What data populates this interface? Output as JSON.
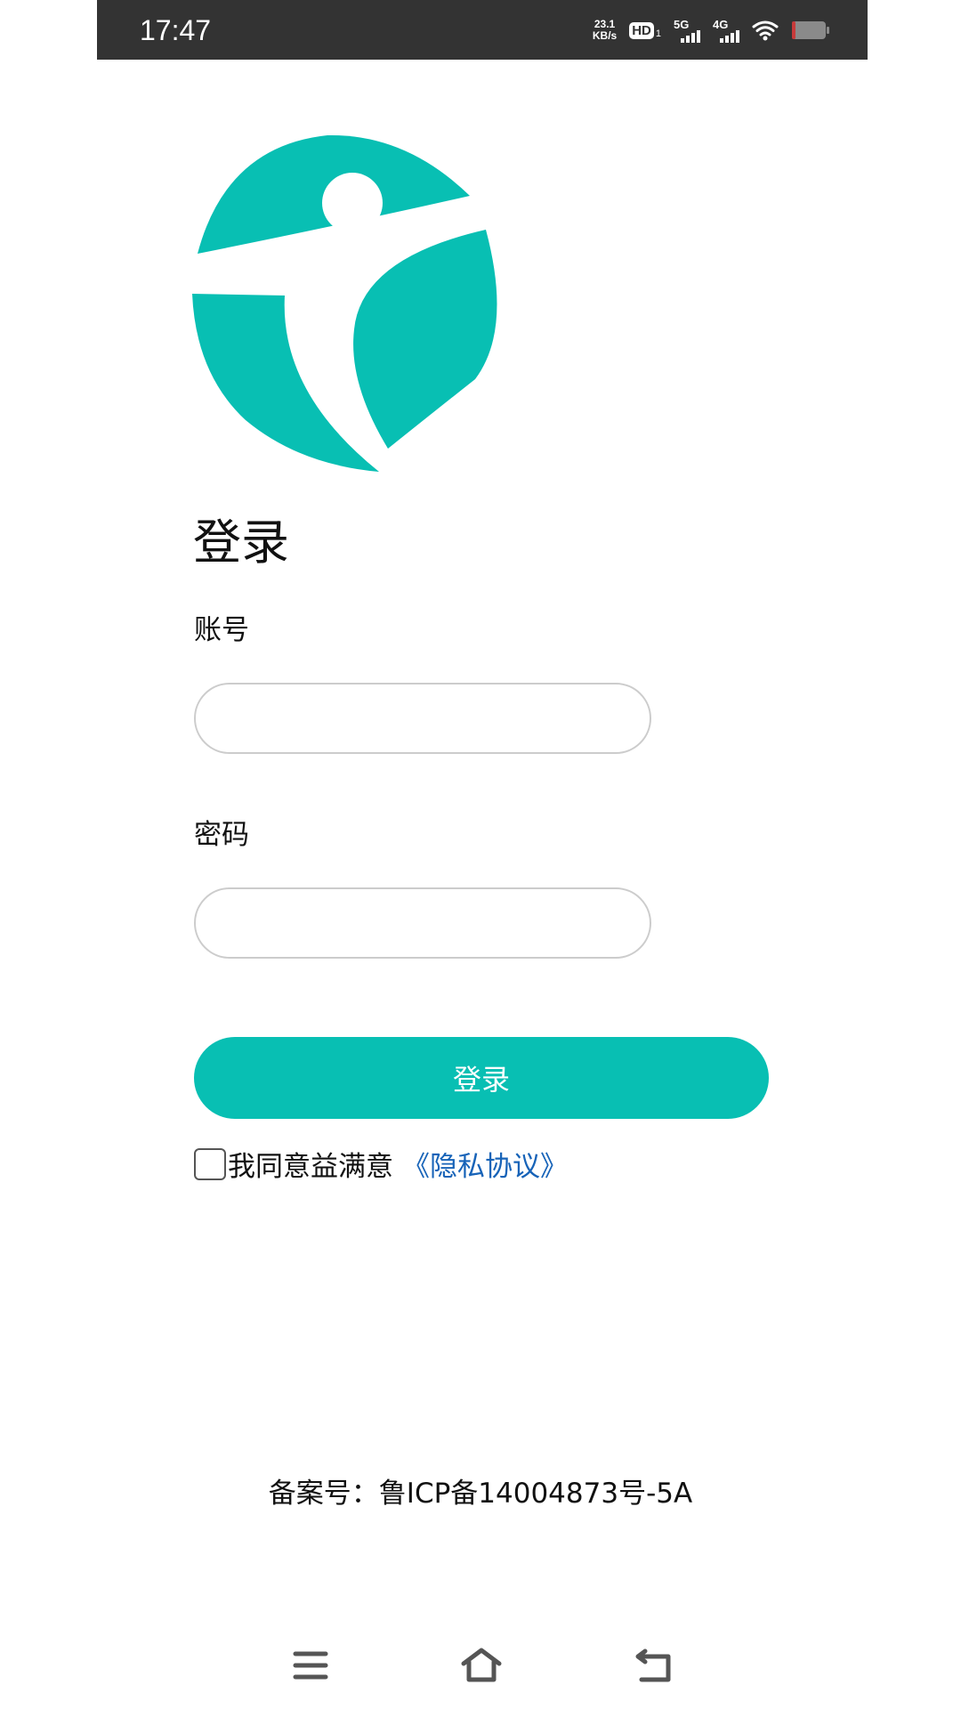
{
  "status_bar": {
    "time": "17:47",
    "net_speed_value": "23.1",
    "net_speed_unit": "KB/s",
    "hd_label": "HD",
    "hd_sub": "1",
    "sim1_label": "5G",
    "sim2_label": "4G",
    "battery_color": "#c83a3a"
  },
  "brand": {
    "logo_icon": "person-leaf-logo-icon",
    "color": "#08bfb3"
  },
  "login": {
    "title": "登录",
    "account_label": "账号",
    "account_value": "",
    "password_label": "密码",
    "password_value": "",
    "button_label": "登录",
    "agree_text": "我同意益满意",
    "privacy_link": "《隐私协议》"
  },
  "footer": {
    "icp": "备案号：鲁ICP备14004873号-5A"
  },
  "nav_bar": {
    "menu_icon": "menu-icon",
    "home_icon": "home-icon",
    "back_icon": "back-icon"
  }
}
